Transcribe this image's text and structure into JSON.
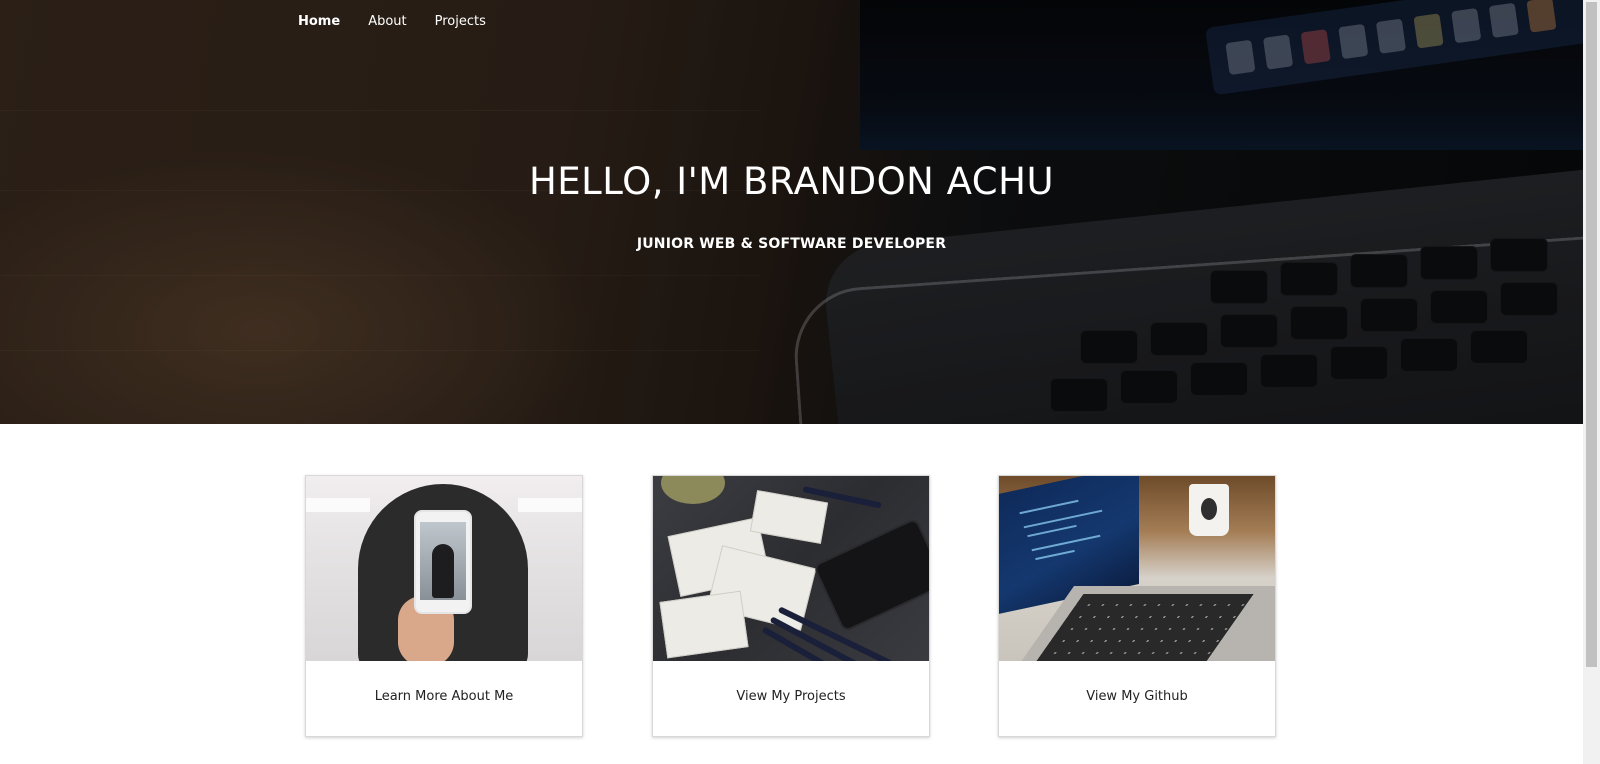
{
  "nav": {
    "items": [
      {
        "label": "Home"
      },
      {
        "label": "About"
      },
      {
        "label": "Projects"
      }
    ]
  },
  "hero": {
    "title": "HELLO, I'M BRANDON ACHU",
    "subtitle": "JUNIOR WEB & SOFTWARE DEVELOPER"
  },
  "cards": [
    {
      "label": "Learn More About Me",
      "image": "person-holding-phone-photo"
    },
    {
      "label": "View My Projects",
      "image": "desk-with-sketches-photo"
    },
    {
      "label": "View My Github",
      "image": "laptop-with-code-photo"
    }
  ],
  "colors": {
    "hero_text": "#ffffff",
    "card_text": "#222222",
    "page_background": "#ffffff"
  }
}
